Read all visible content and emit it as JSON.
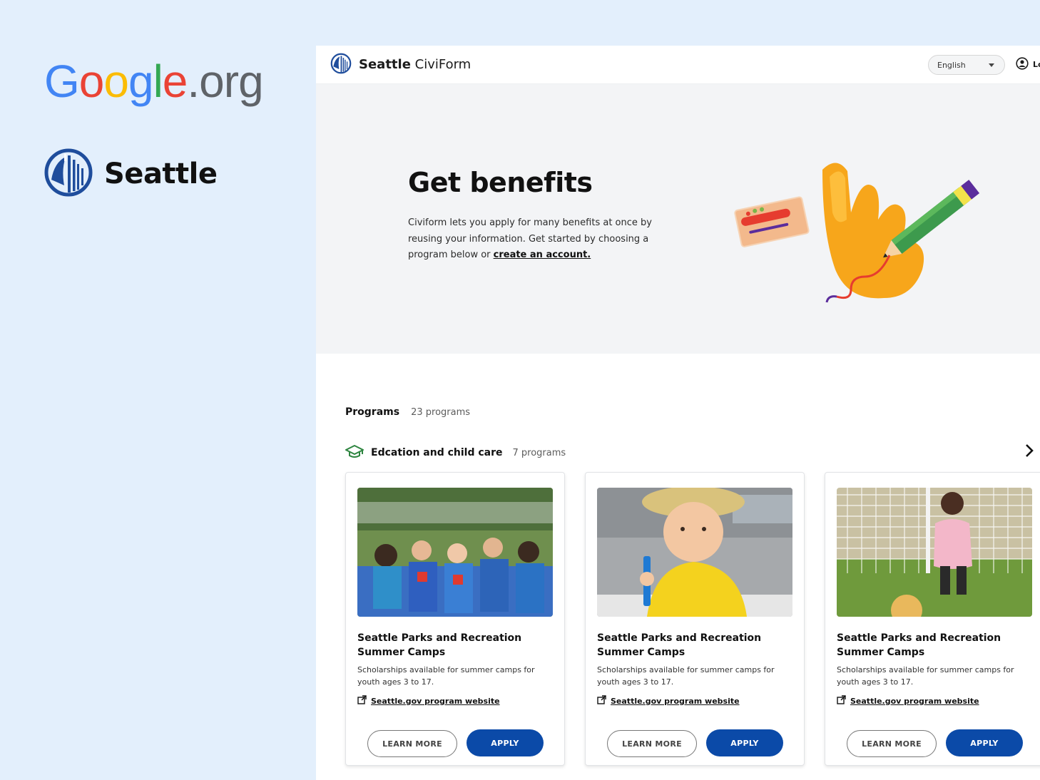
{
  "brand": {
    "google_letters": [
      "G",
      "o",
      "o",
      "g",
      "l",
      "e"
    ],
    "google_suffix": ".org",
    "seattle_label": "Seattle"
  },
  "header": {
    "app_name_bold": "Seattle",
    "app_name_rest": " CiviForm",
    "language": "English",
    "login_label": "Lo"
  },
  "hero": {
    "title": "Get benefits",
    "description": "Civiform lets you apply for many benefits at once by reusing your information. Get started by choosing a program below or ",
    "create_account_link": "create an account."
  },
  "programs": {
    "title": "Programs",
    "count": "23 programs"
  },
  "category": {
    "icon": "graduation-cap-icon",
    "name": "Edcation and child care",
    "count": "7 programs"
  },
  "cards": [
    {
      "title": "Seattle Parks and Recreation Summer Camps",
      "description": "Scholarships available for summer camps for youth ages 3 to 17.",
      "link": "Seattle.gov program website",
      "learn_more": "LEARN MORE",
      "apply": "APPLY"
    },
    {
      "title": "Seattle Parks and Recreation Summer Camps",
      "description": "Scholarships available for summer camps for youth ages 3 to 17.",
      "link": "Seattle.gov program website",
      "learn_more": "LEARN MORE",
      "apply": "APPLY"
    },
    {
      "title": "Seattle Parks and Recreation Summer Camps",
      "description": "Scholarships available for summer camps for youth ages 3 to 17.",
      "link": "Seattle.gov program website",
      "learn_more": "LEARN MORE",
      "apply": "APPLY"
    }
  ],
  "colors": {
    "page_background": "#e3effc",
    "primary_button": "#0b4aa8",
    "seattle_blue": "#1f4d9c",
    "category_icon": "#2e8540"
  }
}
